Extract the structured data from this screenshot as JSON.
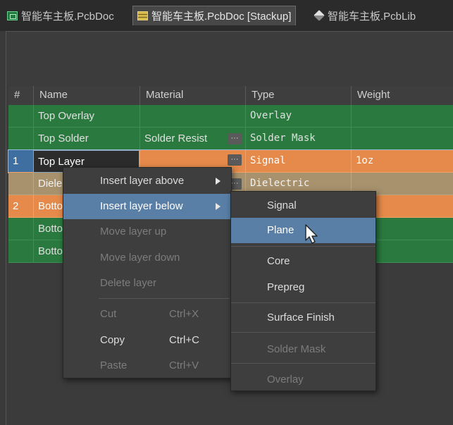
{
  "tabs": [
    {
      "label": "智能车主板.PcbDoc",
      "icon": "pcb-doc-icon",
      "active": false
    },
    {
      "label": "智能车主板.PcbDoc [Stackup]",
      "icon": "stackup-icon",
      "active": true
    },
    {
      "label": "智能车主板.PcbLib",
      "icon": "pcb-lib-icon",
      "active": false
    }
  ],
  "table": {
    "headers": [
      "#",
      "Name",
      "Material",
      "Type",
      "Weight"
    ],
    "rows": [
      {
        "num": "",
        "name": "Top Overlay",
        "material": "",
        "type": "Overlay",
        "weight": "",
        "color": "green"
      },
      {
        "num": "",
        "name": "Top Solder",
        "material": "Solder Resist",
        "type": "Solder Mask",
        "weight": "",
        "color": "green"
      },
      {
        "num": "1",
        "name": "Top Layer",
        "material": "",
        "type": "Signal",
        "weight": "1oz",
        "color": "orange",
        "selected": true
      },
      {
        "num": "",
        "name": "Diele",
        "material": "",
        "type": "Dielectric",
        "weight": "",
        "color": "tan"
      },
      {
        "num": "2",
        "name": "Botto",
        "material": "",
        "type": "",
        "weight": "",
        "color": "orange"
      },
      {
        "num": "",
        "name": "Botto",
        "material": "",
        "type": "",
        "weight": "",
        "color": "green"
      },
      {
        "num": "",
        "name": "Botto",
        "material": "",
        "type": "",
        "weight": "",
        "color": "green"
      }
    ],
    "ellipsis": "···"
  },
  "context_menu": {
    "items": [
      {
        "label": "Insert layer above",
        "shortcut": "",
        "enabled": true,
        "submenu": true
      },
      {
        "label": "Insert layer below",
        "shortcut": "",
        "enabled": true,
        "submenu": true,
        "highlighted": true
      },
      {
        "label": "Move layer up",
        "shortcut": "",
        "enabled": false
      },
      {
        "label": "Move layer down",
        "shortcut": "",
        "enabled": false
      },
      {
        "label": "Delete layer",
        "shortcut": "",
        "enabled": false
      },
      {
        "label": "Cut",
        "shortcut": "Ctrl+X",
        "enabled": false
      },
      {
        "label": "Copy",
        "shortcut": "Ctrl+C",
        "enabled": true
      },
      {
        "label": "Paste",
        "shortcut": "Ctrl+V",
        "enabled": false
      }
    ]
  },
  "submenu": {
    "items": [
      {
        "label": "Signal",
        "enabled": true
      },
      {
        "label": "Plane",
        "enabled": true,
        "highlighted": true
      },
      {
        "label": "Core",
        "enabled": true
      },
      {
        "label": "Prepreg",
        "enabled": true
      },
      {
        "label": "Surface Finish",
        "enabled": true
      },
      {
        "label": "Solder Mask",
        "enabled": false
      },
      {
        "label": "Overlay",
        "enabled": false
      }
    ]
  },
  "colors": {
    "row_green": "#2a7a3f",
    "row_orange": "#e58a4a",
    "row_tan": "#a7926d",
    "menu_highlight": "#5a7fa6"
  }
}
